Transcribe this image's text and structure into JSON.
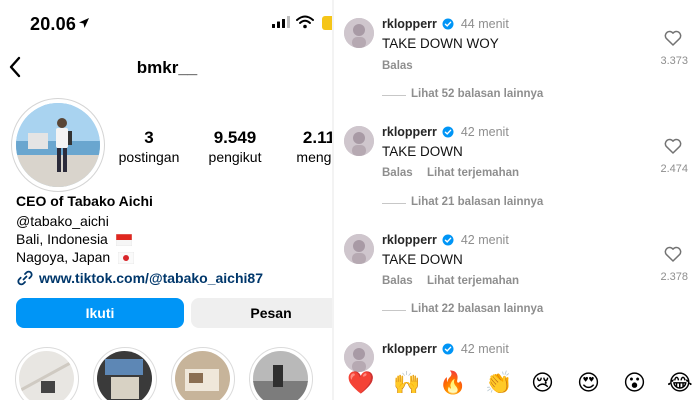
{
  "status_bar": {
    "time": "20.06"
  },
  "profile": {
    "username": "bmkr__",
    "stats": [
      {
        "value": "3",
        "label": "postingan"
      },
      {
        "value": "9.549",
        "label": "pengikut"
      },
      {
        "value": "2.11",
        "label": "mengik"
      }
    ],
    "bio": {
      "name": "CEO of Tabako Aichi",
      "handle": "@tabako_aichi",
      "location1": "Bali, Indonesia",
      "location2": "Nagoya, Japan",
      "link": "www.tiktok.com/@tabako_aichi87"
    },
    "follow_label": "Ikuti",
    "message_label": "Pesan"
  },
  "comments": [
    {
      "user": "rklopperr",
      "time": "44 menit",
      "text": "TAKE DOWN WOY",
      "reply": "Balas",
      "translate": "",
      "more": "Lihat 52 balasan lainnya",
      "likes": "3.373"
    },
    {
      "user": "rklopperr",
      "time": "42 menit",
      "text": "TAKE DOWN",
      "reply": "Balas",
      "translate": "Lihat terjemahan",
      "more": "Lihat 21 balasan lainnya",
      "likes": "2.474"
    },
    {
      "user": "rklopperr",
      "time": "42 menit",
      "text": "TAKE DOWN",
      "reply": "Balas",
      "translate": "Lihat terjemahan",
      "more": "Lihat 22 balasan lainnya",
      "likes": "2.378"
    },
    {
      "user": "rklopperr",
      "time": "42 menit"
    }
  ],
  "emojis": [
    "❤️",
    "🙌",
    "🔥",
    "👏",
    "😢",
    "😍",
    "😮",
    "😂"
  ],
  "colors": {
    "accent": "#0095f6",
    "verified": "#0095f6",
    "link": "#00376b"
  },
  "icons": [
    "location-arrow-icon",
    "signal-icon",
    "wifi-icon",
    "battery-icon",
    "back-chevron-icon",
    "link-icon",
    "heart-outline-icon",
    "verified-badge-icon"
  ]
}
